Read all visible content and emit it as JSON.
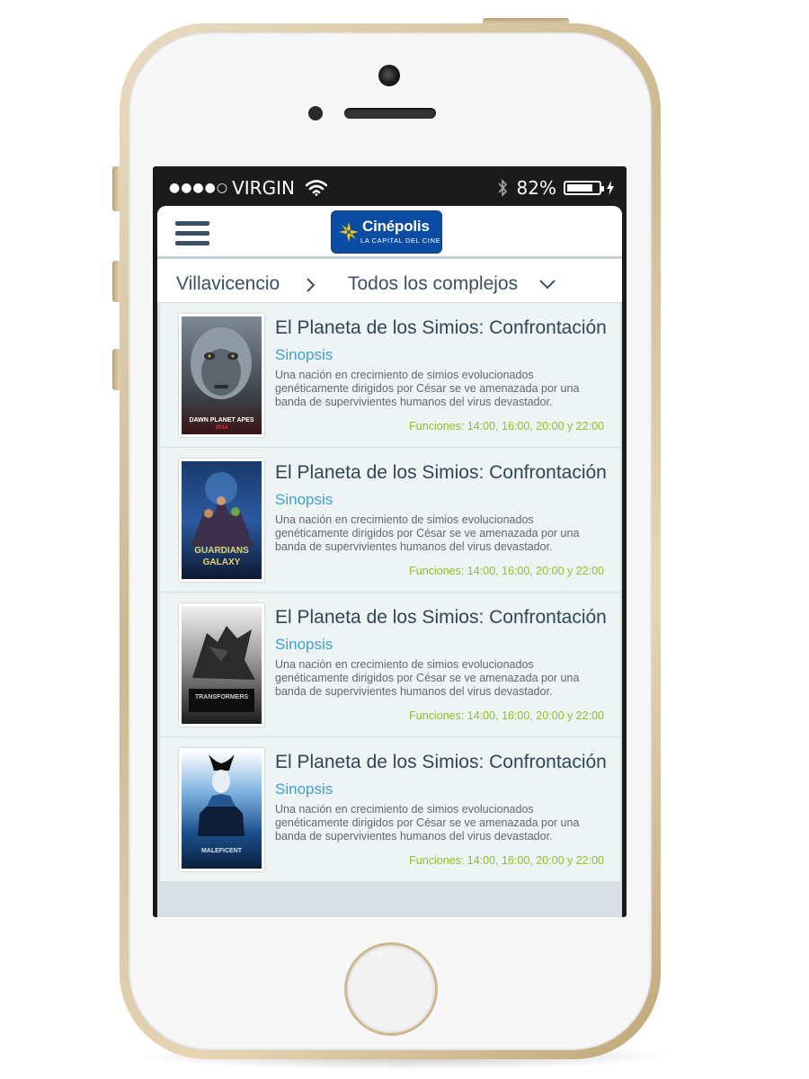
{
  "status_bar": {
    "carrier": "VIRGIN",
    "signal_dots": "●●●●○",
    "battery_percent": "82%",
    "battery_level": 0.82,
    "icons": [
      "wifi-icon",
      "bluetooth-icon",
      "battery-icon",
      "charging-bolt-icon"
    ]
  },
  "app_bar": {
    "menu_icon": "hamburger-menu-icon",
    "logo": {
      "name": "Cinépolis",
      "tagline": "LA CAPITAL DEL CINE",
      "brand_color": "#0b4da2"
    }
  },
  "filters": {
    "city": "Villavicencio",
    "complex": "Todos los complejos"
  },
  "colors": {
    "title": "#2e4558",
    "link": "#3f9fd0",
    "showtimes": "#8cbf2c",
    "row_bg": "#eef4f4"
  },
  "movies": [
    {
      "title": "El Planeta de los Simios: Confrontación",
      "synopsis_label": "Sinopsis",
      "synopsis": "Una nación en crecimiento de simios evolucionados genéticamente dirigidos por César se ve amenazada por una banda de supervivientes humanos del virus devastador.",
      "showtimes": "Funciones: 14:00, 16:00, 20:00 y 22:00",
      "poster_caption": "DAWN PLANET APES",
      "poster_caption_2": "2014"
    },
    {
      "title": "El Planeta de los Simios: Confrontación",
      "synopsis_label": "Sinopsis",
      "synopsis": "Una nación en crecimiento de simios evolucionados genéticamente dirigidos por César se ve amenazada por una banda de supervivientes humanos del virus devastador.",
      "showtimes": "Funciones: 14:00, 16:00, 20:00 y 22:00",
      "poster_caption": "GUARDIANS",
      "poster_caption_2": "GALAXY"
    },
    {
      "title": "El Planeta de los Simios: Confrontación",
      "synopsis_label": "Sinopsis",
      "synopsis": "Una nación en crecimiento de simios evolucionados genéticamente dirigidos por César se ve amenazada por una banda de supervivientes humanos del virus devastador.",
      "showtimes": "Funciones: 14:00, 16:00, 20:00 y 22:00",
      "poster_caption": "TRANSFORMERS",
      "poster_caption_2": ""
    },
    {
      "title": "El Planeta de los Simios: Confrontación",
      "synopsis_label": "Sinopsis",
      "synopsis": "Una nación en crecimiento de simios evolucionados genéticamente dirigidos por César se ve amenazada por una banda de supervivientes humanos del virus devastador.",
      "showtimes": "Funciones: 14:00, 16:00, 20:00 y 22:00",
      "poster_caption": "MALEFICENT",
      "poster_caption_2": ""
    }
  ]
}
